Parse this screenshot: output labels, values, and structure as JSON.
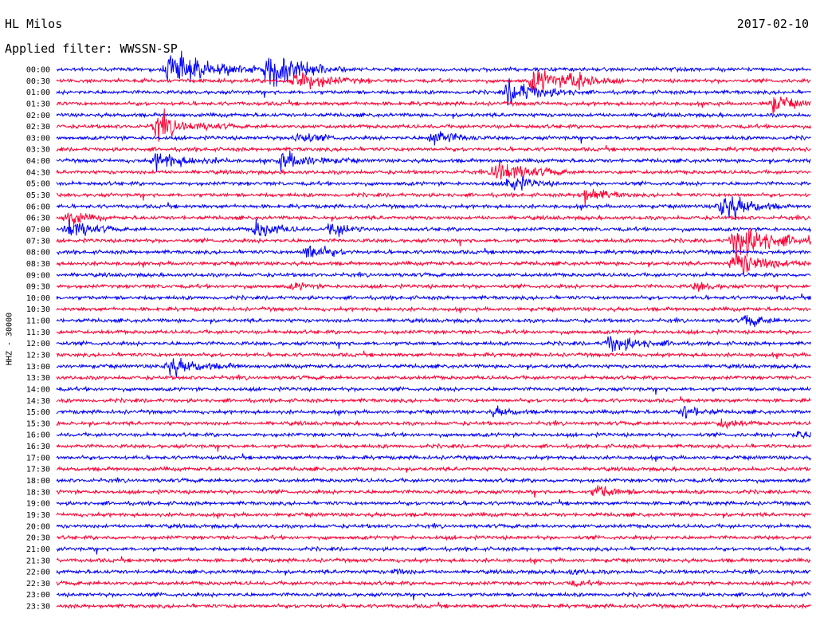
{
  "header": {
    "station": "HL Milos",
    "filter": "Applied filter: WWSSN-SP",
    "date": "2017-02-10"
  },
  "chart_data": {
    "type": "line",
    "title": "HL Milos",
    "subtitle": "Applied filter: WWSSN-SP",
    "date": "2017-02-10",
    "ylabel": "HHZ - 30000",
    "xlabel": "",
    "trace_colors": [
      "#0000ff",
      "#ff0033"
    ],
    "row_labels": [
      "00:00",
      "00:30",
      "01:00",
      "01:30",
      "02:00",
      "02:30",
      "03:00",
      "03:30",
      "04:00",
      "04:30",
      "05:00",
      "05:30",
      "06:00",
      "06:30",
      "07:00",
      "07:30",
      "08:00",
      "08:30",
      "09:00",
      "09:30",
      "10:00",
      "10:30",
      "11:00",
      "11:30",
      "12:00",
      "12:30",
      "13:00",
      "13:30",
      "14:00",
      "14:30",
      "15:00",
      "15:30",
      "16:00",
      "16:30",
      "17:00",
      "17:30",
      "18:00",
      "18:30",
      "19:00",
      "19:30",
      "20:00",
      "20:30",
      "21:00",
      "21:30",
      "22:00",
      "22:30",
      "23:00",
      "23:30"
    ],
    "row_minutes": 30,
    "events": [
      {
        "row": 0,
        "minute": 4.5,
        "amplitude": 8,
        "duration": 4
      },
      {
        "row": 0,
        "minute": 8.5,
        "amplitude": 10,
        "duration": 3
      },
      {
        "row": 1,
        "minute": 9.5,
        "amplitude": 5,
        "duration": 3
      },
      {
        "row": 1,
        "minute": 19,
        "amplitude": 6,
        "duration": 2.5
      },
      {
        "row": 1,
        "minute": 20.5,
        "amplitude": 5,
        "duration": 2
      },
      {
        "row": 2,
        "minute": 18,
        "amplitude": 6,
        "duration": 3
      },
      {
        "row": 3,
        "minute": 28.5,
        "amplitude": 4,
        "duration": 2
      },
      {
        "row": 5,
        "minute": 4,
        "amplitude": 5,
        "duration": 3
      },
      {
        "row": 6,
        "minute": 15,
        "amplitude": 4,
        "duration": 2
      },
      {
        "row": 6,
        "minute": 9.5,
        "amplitude": 3,
        "duration": 2
      },
      {
        "row": 8,
        "minute": 4,
        "amplitude": 4,
        "duration": 3
      },
      {
        "row": 8,
        "minute": 9,
        "amplitude": 4,
        "duration": 3
      },
      {
        "row": 9,
        "minute": 17.5,
        "amplitude": 6,
        "duration": 3
      },
      {
        "row": 10,
        "minute": 18,
        "amplitude": 4,
        "duration": 2
      },
      {
        "row": 11,
        "minute": 21,
        "amplitude": 4,
        "duration": 2
      },
      {
        "row": 12,
        "minute": 26.5,
        "amplitude": 7,
        "duration": 2.5
      },
      {
        "row": 13,
        "minute": 0.5,
        "amplitude": 4,
        "duration": 1.5
      },
      {
        "row": 14,
        "minute": 0.5,
        "amplitude": 5,
        "duration": 2
      },
      {
        "row": 14,
        "minute": 8,
        "amplitude": 4,
        "duration": 2
      },
      {
        "row": 14,
        "minute": 11,
        "amplitude": 4,
        "duration": 1.5
      },
      {
        "row": 15,
        "minute": 27,
        "amplitude": 8,
        "duration": 4
      },
      {
        "row": 16,
        "minute": 10,
        "amplitude": 4,
        "duration": 2
      },
      {
        "row": 17,
        "minute": 27,
        "amplitude": 6,
        "duration": 3
      },
      {
        "row": 19,
        "minute": 25.5,
        "amplitude": 2,
        "duration": 1.5
      },
      {
        "row": 19,
        "minute": 9.5,
        "amplitude": 1.5,
        "duration": 1.5
      },
      {
        "row": 22,
        "minute": 27.5,
        "amplitude": 3,
        "duration": 1.5
      },
      {
        "row": 24,
        "minute": 22,
        "amplitude": 4,
        "duration": 3
      },
      {
        "row": 26,
        "minute": 4.5,
        "amplitude": 4,
        "duration": 3
      },
      {
        "row": 30,
        "minute": 17.5,
        "amplitude": 2,
        "duration": 1.5
      },
      {
        "row": 30,
        "minute": 25,
        "amplitude": 3,
        "duration": 1.5
      },
      {
        "row": 31,
        "minute": 26.5,
        "amplitude": 2,
        "duration": 1.5
      },
      {
        "row": 32,
        "minute": 29.5,
        "amplitude": 2,
        "duration": 1
      },
      {
        "row": 37,
        "minute": 21.5,
        "amplitude": 3,
        "duration": 2
      },
      {
        "row": 44,
        "minute": 13.5,
        "amplitude": 1.5,
        "duration": 1
      },
      {
        "row": 44,
        "minute": 20.5,
        "amplitude": 1,
        "duration": 1.5
      },
      {
        "row": 45,
        "minute": 20.5,
        "amplitude": 1,
        "duration": 1.5
      }
    ]
  }
}
